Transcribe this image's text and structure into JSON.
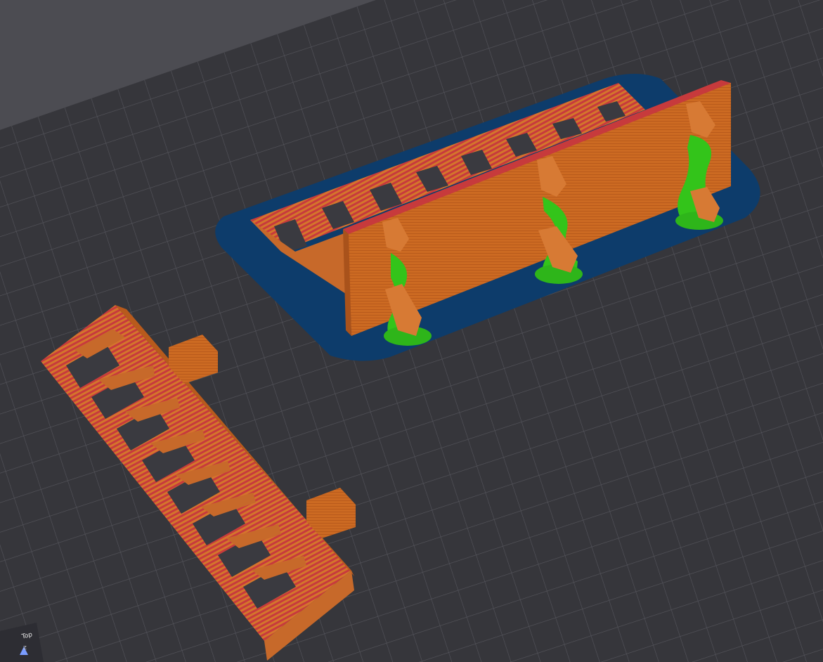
{
  "viewer": {
    "view_cube_label": "Top",
    "axis_label": "Z"
  },
  "colors": {
    "background": "#4a4a4f",
    "bed": "#343439",
    "grid": "#4c4c52",
    "wall": "#c8661f",
    "infill": "#c2323a",
    "support": "#3ac21e",
    "brim": "#0f3f6e"
  }
}
